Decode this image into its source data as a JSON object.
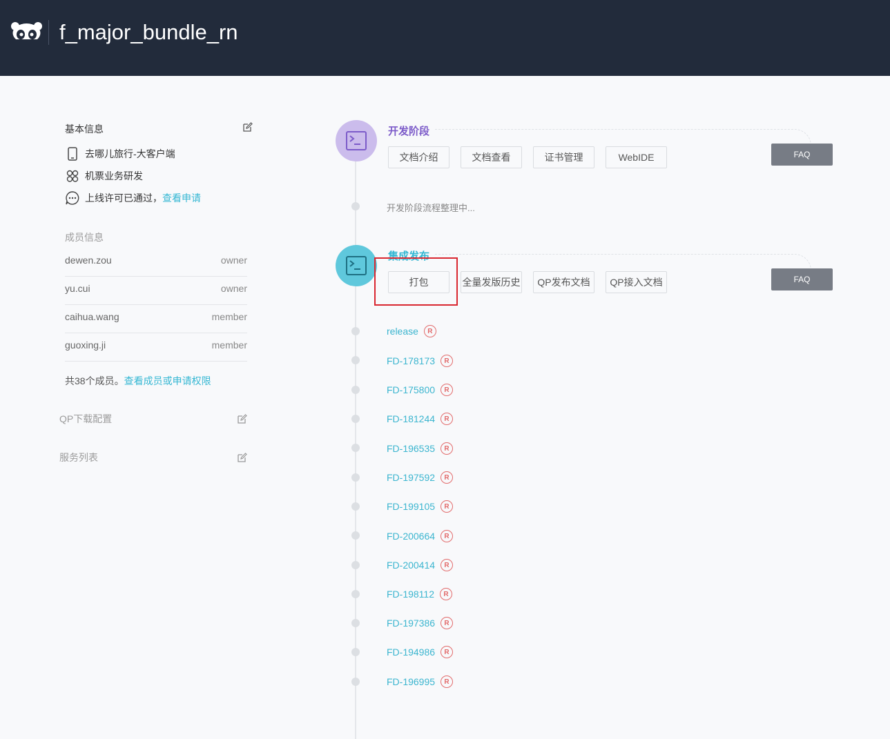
{
  "header": {
    "title": "f_major_bundle_rn",
    "logo_icon": "panda-logo-icon"
  },
  "basic_info": {
    "title": "基本信息",
    "platform": "去哪儿旅行-大客户端",
    "team": "机票业务研发",
    "license_text": "上线许可已通过，",
    "license_link": "查看申请"
  },
  "members": {
    "title": "成员信息",
    "list": [
      {
        "name": "dewen.zou",
        "role": "owner"
      },
      {
        "name": "yu.cui",
        "role": "owner"
      },
      {
        "name": "caihua.wang",
        "role": "member"
      },
      {
        "name": "guoxing.ji",
        "role": "member"
      }
    ],
    "total_text": "共38个成员。",
    "total_link": "查看成员或申请权限"
  },
  "qp_config": {
    "title": "QP下载配置"
  },
  "service_list": {
    "title": "服务列表"
  },
  "stages": [
    {
      "title": "开发阶段",
      "color": "#7c5bc9",
      "buttons": [
        "文档介绍",
        "文档查看",
        "证书管理",
        "WebIDE"
      ],
      "faq": "FAQ",
      "progress": "开发阶段流程整理中..."
    },
    {
      "title": "集成发布",
      "color": "#35b7d3",
      "buttons": [
        "打包",
        "全量发版历史",
        "QP发布文档",
        "QP接入文档"
      ],
      "faq": "FAQ"
    }
  ],
  "branches": [
    {
      "name": "release",
      "badge": "R"
    },
    {
      "name": "FD-178173",
      "badge": "R"
    },
    {
      "name": "FD-175800",
      "badge": "R"
    },
    {
      "name": "FD-181244",
      "badge": "R"
    },
    {
      "name": "FD-196535",
      "badge": "R"
    },
    {
      "name": "FD-197592",
      "badge": "R"
    },
    {
      "name": "FD-199105",
      "badge": "R"
    },
    {
      "name": "FD-200664",
      "badge": "R"
    },
    {
      "name": "FD-200414",
      "badge": "R"
    },
    {
      "name": "FD-198112",
      "badge": "R"
    },
    {
      "name": "FD-197386",
      "badge": "R"
    },
    {
      "name": "FD-194986",
      "badge": "R"
    },
    {
      "name": "FD-196995",
      "badge": "R"
    }
  ]
}
